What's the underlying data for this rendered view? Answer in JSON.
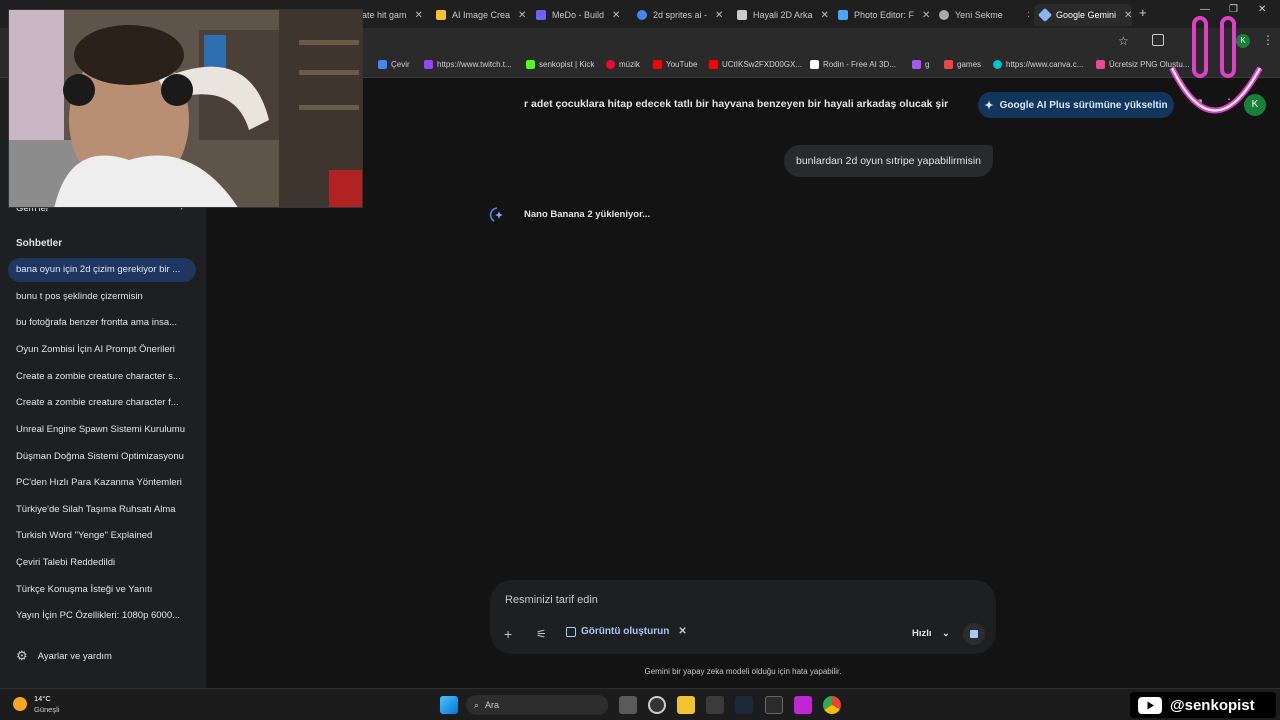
{
  "tabs": [
    {
      "label": "ate hit gam",
      "color": "#ff9f43"
    },
    {
      "label": "AI Image Crea",
      "color": "#f4c430"
    },
    {
      "label": "MeDo - Build",
      "color": "#6c63ff"
    },
    {
      "label": "2d sprites ai -",
      "color": "#4285f4"
    },
    {
      "label": "Hayali 2D Arka",
      "color": "#cccccc"
    },
    {
      "label": "Photo Editor: F",
      "color": "#4aa3ff"
    },
    {
      "label": "Yeni Sekme",
      "color": "#aaaaaa"
    },
    {
      "label": "Google Gemini",
      "color": "#8ab4f8"
    }
  ],
  "bookmarks": [
    {
      "label": "Çevir",
      "color": "#4285f4"
    },
    {
      "label": "https://www.twitch.t...",
      "color": "#9146ff"
    },
    {
      "label": "senkopist | Kick",
      "color": "#53fc18"
    },
    {
      "label": "müzik",
      "color": "#ff0033"
    },
    {
      "label": "YouTube",
      "color": "#ff0000"
    },
    {
      "label": "UCtIKSw2FXD00GX...",
      "color": "#ff0000"
    },
    {
      "label": "Rodin - Free AI 3D...",
      "color": "#ffffff"
    },
    {
      "label": "g",
      "color": "#a855f7"
    },
    {
      "label": "games",
      "color": "#ef4444"
    },
    {
      "label": "https://www.canva.c...",
      "color": "#00c4cc"
    },
    {
      "label": "Ücretsiz PNG Oluştu...",
      "color": "#ec4899"
    }
  ],
  "sidebar": {
    "gems_label": "Gem'ler",
    "chats_heading": "Sohbetler",
    "chats": [
      "bana oyun için 2d çizim gerekiyor bir ...",
      "bunu t pos şeklinde çizermisin",
      "bu fotoğrafa benzer frontta ama insa...",
      "Oyun Zombisi İçin AI Prompt Önerileri",
      "Create a zombie creature character s...",
      "Create a zombie creature character f...",
      "Unreal Engine Spawn Sistemi Kurulumu",
      "Düşman Doğma Sistemi Optimizasyonu",
      "PC'den Hızlı Para Kazanma Yöntemleri",
      "Türkiye'de Silah Taşıma Ruhsatı Alma",
      "Turkish Word \"Yenge\" Explained",
      "Çeviri Talebi Reddedildi",
      "Türkçe Konuşma İsteği ve Yanıtı",
      "Yayın İçin PC Özellikleri: 1080p 6000..."
    ],
    "settings_label": "Ayarlar ve yardım"
  },
  "main": {
    "prompt_line": "r adet çocuklara hitap edecek tatlı bir hayvana benzeyen bir hayali arkadaş olucak şir",
    "upgrade_label": "Google AI Plus sürümüne yükseltin",
    "user_message": "bunlardan 2d oyun sıtripe yapabilirmisin",
    "status": "Nano Banana 2 yükleniyor...",
    "composer_placeholder": "Resminizi tarif edin",
    "image_chip": "Görüntü oluşturun",
    "speed": "Hızlı",
    "disclaimer": "Gemini bir yapay zeka modeli olduğu için hata yapabilir."
  },
  "taskbar": {
    "weather_temp": "14°C",
    "weather_desc": "Güneşli",
    "search_label": "Ara"
  },
  "overlay": {
    "channel": "@senkopist"
  }
}
